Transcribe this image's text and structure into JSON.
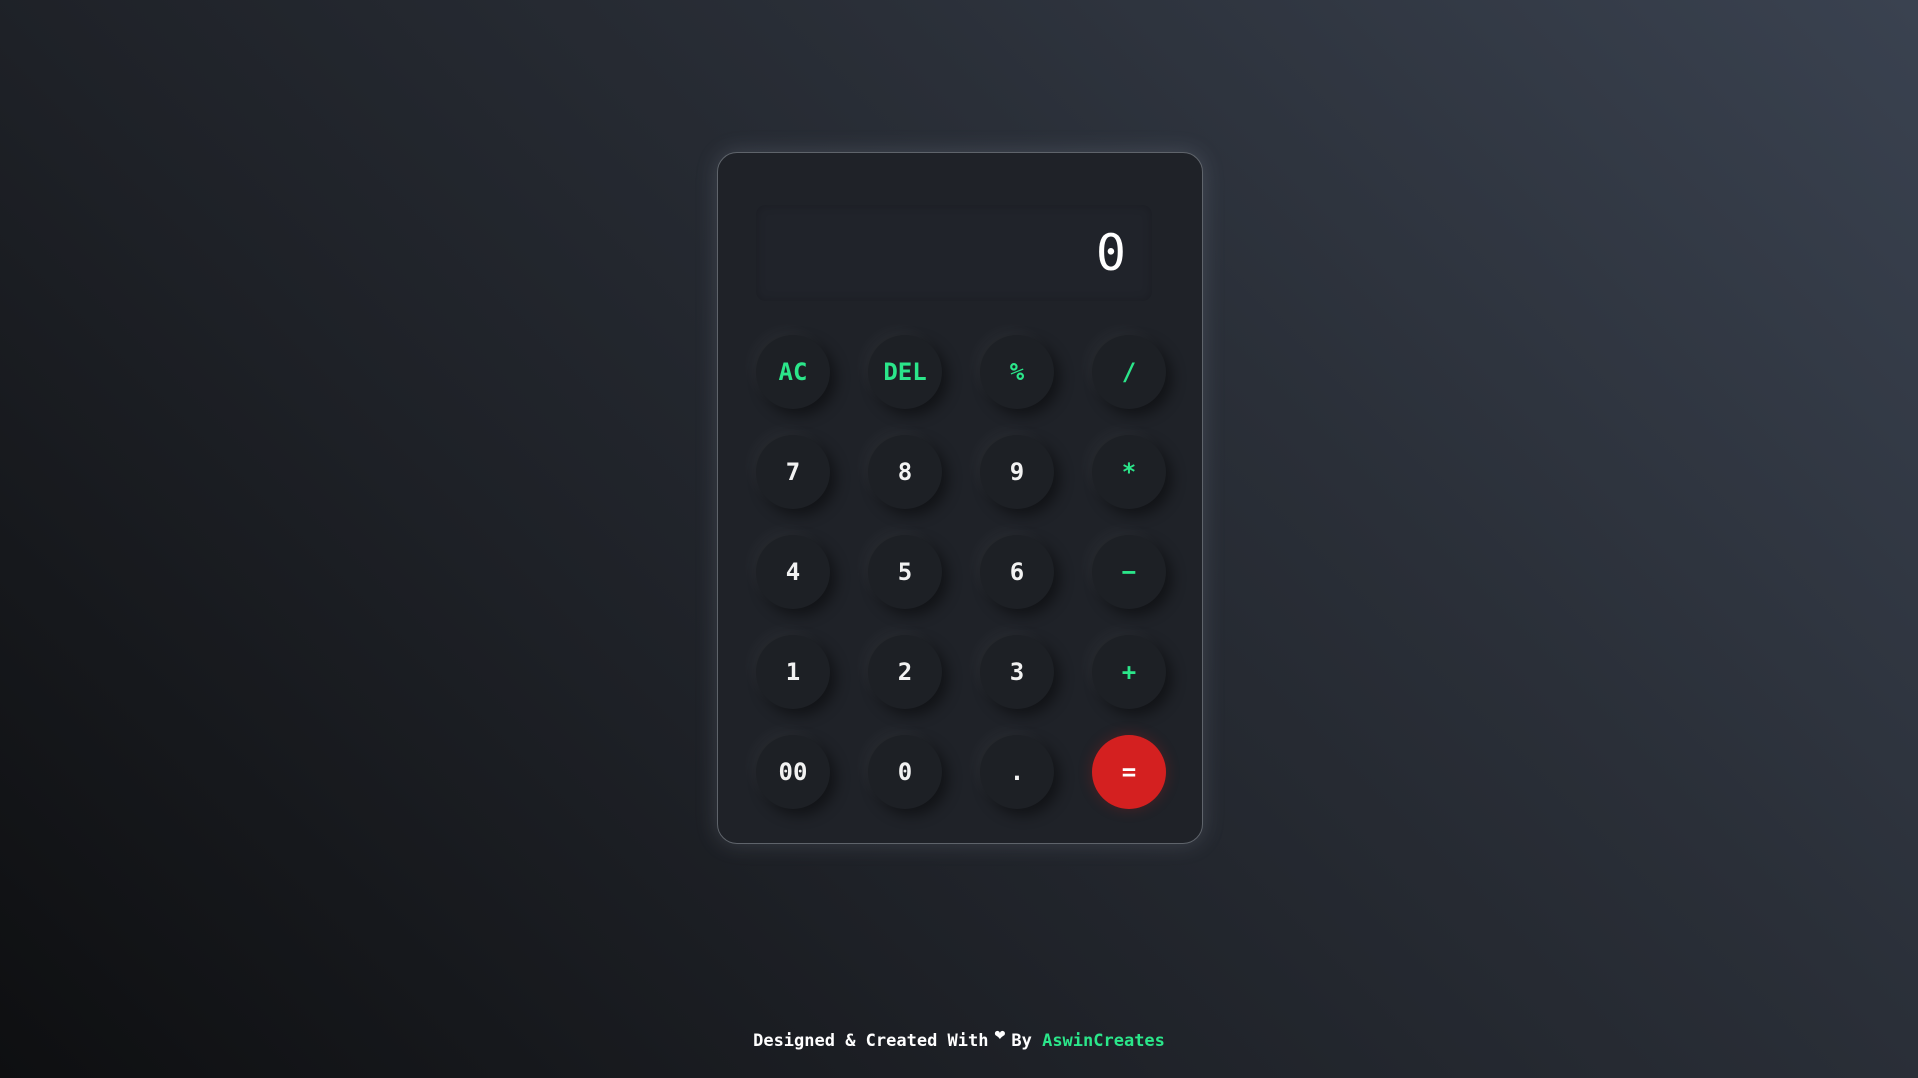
{
  "display": {
    "value": "0"
  },
  "keys": [
    {
      "label": "AC",
      "name": "clear-button",
      "kind": "op"
    },
    {
      "label": "DEL",
      "name": "delete-button",
      "kind": "op"
    },
    {
      "label": "%",
      "name": "percent-button",
      "kind": "op"
    },
    {
      "label": "/",
      "name": "divide-button",
      "kind": "op"
    },
    {
      "label": "7",
      "name": "digit-7-button",
      "kind": "num"
    },
    {
      "label": "8",
      "name": "digit-8-button",
      "kind": "num"
    },
    {
      "label": "9",
      "name": "digit-9-button",
      "kind": "num"
    },
    {
      "label": "*",
      "name": "multiply-button",
      "kind": "op"
    },
    {
      "label": "4",
      "name": "digit-4-button",
      "kind": "num"
    },
    {
      "label": "5",
      "name": "digit-5-button",
      "kind": "num"
    },
    {
      "label": "6",
      "name": "digit-6-button",
      "kind": "num"
    },
    {
      "label": "−",
      "name": "subtract-button",
      "kind": "op"
    },
    {
      "label": "1",
      "name": "digit-1-button",
      "kind": "num"
    },
    {
      "label": "2",
      "name": "digit-2-button",
      "kind": "num"
    },
    {
      "label": "3",
      "name": "digit-3-button",
      "kind": "num"
    },
    {
      "label": "+",
      "name": "add-button",
      "kind": "op"
    },
    {
      "label": "00",
      "name": "double-zero-button",
      "kind": "num"
    },
    {
      "label": "0",
      "name": "digit-0-button",
      "kind": "num"
    },
    {
      "label": ".",
      "name": "decimal-point-button",
      "kind": "num"
    },
    {
      "label": "=",
      "name": "equals-button",
      "kind": "equals"
    }
  ],
  "footer": {
    "prefix": "Designed & Created With",
    "heart_icon": "heart-icon",
    "by": "By",
    "author": "AswinCreates"
  },
  "colors": {
    "accent": "#2be68a",
    "equals": "#d42020",
    "panel": "#1f2228"
  }
}
